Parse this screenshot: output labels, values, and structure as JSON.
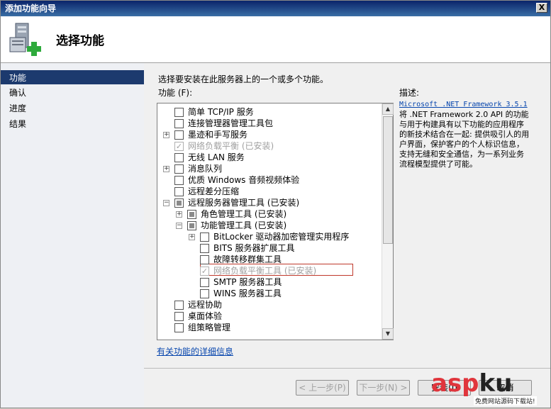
{
  "window": {
    "title": "添加功能向导",
    "close": "X"
  },
  "header": {
    "title": "选择功能",
    "icon": "server-add-icon"
  },
  "nav": [
    "功能",
    "确认",
    "进度",
    "结果"
  ],
  "main": {
    "instruction": "选择要安装在此服务器上的一个或多个功能。",
    "features_label": "功能 (F):",
    "more_info": "有关功能的详细信息"
  },
  "tree": [
    {
      "label": "简单 TCP/IP 服务",
      "indent": 0,
      "expander": "",
      "state": "unchecked"
    },
    {
      "label": "连接管理器管理工具包",
      "indent": 0,
      "expander": "",
      "state": "unchecked"
    },
    {
      "label": "墨迹和手写服务",
      "indent": 0,
      "expander": "+",
      "state": "unchecked"
    },
    {
      "label": "网络负载平衡  (已安装)",
      "indent": 0,
      "expander": "",
      "state": "disabled-checked"
    },
    {
      "label": "无线 LAN 服务",
      "indent": 0,
      "expander": "",
      "state": "unchecked"
    },
    {
      "label": "消息队列",
      "indent": 0,
      "expander": "+",
      "state": "unchecked"
    },
    {
      "label": "优质 Windows 音频视频体验",
      "indent": 0,
      "expander": "",
      "state": "unchecked"
    },
    {
      "label": "远程差分压缩",
      "indent": 0,
      "expander": "",
      "state": "unchecked"
    },
    {
      "label": "远程服务器管理工具  (已安装)",
      "indent": 0,
      "expander": "−",
      "state": "partial"
    },
    {
      "label": "角色管理工具  (已安装)",
      "indent": 1,
      "expander": "+",
      "state": "partial"
    },
    {
      "label": "功能管理工具  (已安装)",
      "indent": 1,
      "expander": "−",
      "state": "partial"
    },
    {
      "label": "BitLocker 驱动器加密管理实用程序",
      "indent": 2,
      "expander": "+",
      "state": "unchecked"
    },
    {
      "label": "BITS 服务器扩展工具",
      "indent": 2,
      "expander": "",
      "state": "unchecked"
    },
    {
      "label": "故障转移群集工具",
      "indent": 2,
      "expander": "",
      "state": "unchecked"
    },
    {
      "label": "网络负载平衡工具  (已安装)",
      "indent": 2,
      "expander": "",
      "state": "disabled-checked"
    },
    {
      "label": "SMTP 服务器工具",
      "indent": 2,
      "expander": "",
      "state": "unchecked"
    },
    {
      "label": "WINS 服务器工具",
      "indent": 2,
      "expander": "",
      "state": "unchecked"
    },
    {
      "label": "远程协助",
      "indent": 0,
      "expander": "",
      "state": "unchecked"
    },
    {
      "label": "桌面体验",
      "indent": 0,
      "expander": "",
      "state": "unchecked"
    },
    {
      "label": "组策略管理",
      "indent": 0,
      "expander": "",
      "state": "unchecked"
    }
  ],
  "description": {
    "label": "描述:",
    "link": "Microsoft .NET Framework 3.5.1",
    "text": "将 .NET Framework 2.0 API 的功能与用于构建具有以下功能的应用程序的新技术结合在一起: 提供吸引人的用户界面，保护客户的个人标识信息，支持无缝和安全通信，为一系列业务流程模型提供了可能。"
  },
  "buttons": {
    "prev": "< 上一步(P)",
    "next": "下一步(N) >",
    "install": "安装(I)",
    "cancel": "取消"
  },
  "watermark": {
    "main_a": "asp",
    "main_b": "ku",
    "sub": "免费网站源码下载站!"
  }
}
